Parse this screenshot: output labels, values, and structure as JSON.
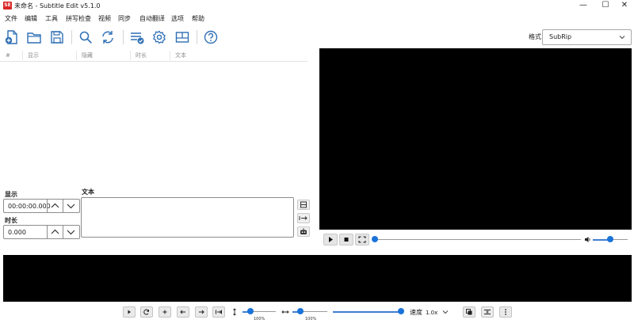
{
  "window": {
    "logo_text": "SE",
    "title": "未命名 - Subtitle Edit v5.1.0",
    "minimize": "—",
    "maximize": "☐",
    "close": "✕"
  },
  "menu": [
    "文件",
    "编辑",
    "工具",
    "拼写检查",
    "视频",
    "同步",
    "自动翻译",
    "选项",
    "帮助"
  ],
  "toolbar": {
    "icons": [
      "new-file-icon",
      "open-folder-icon",
      "save-icon",
      "search-icon",
      "replace-icon",
      "fix-errors-icon",
      "settings-icon",
      "layout-icon",
      "help-icon"
    ],
    "format_label": "格式",
    "format_value": "SubRip"
  },
  "subtitle_list": {
    "columns": [
      "#",
      "显示",
      "隐藏",
      "时长",
      "文本"
    ],
    "rows": []
  },
  "editor": {
    "show_label": "显示",
    "show_value": "00:00:00.000",
    "duration_label": "时长",
    "duration_value": "0.000",
    "text_label": "文本",
    "text_value": ""
  },
  "video": {
    "progress": 0,
    "volume": 0.5
  },
  "waveform_toolbar": {
    "vertical_zoom_label": "100%",
    "horizontal_zoom_label": "100%",
    "speed_label": "速度",
    "speed_value": "1.0x"
  },
  "colors": {
    "accent": "#1a73d9",
    "icon_blue": "#2f6fb5",
    "logo_red": "#d92626",
    "video_bg": "#000000"
  }
}
